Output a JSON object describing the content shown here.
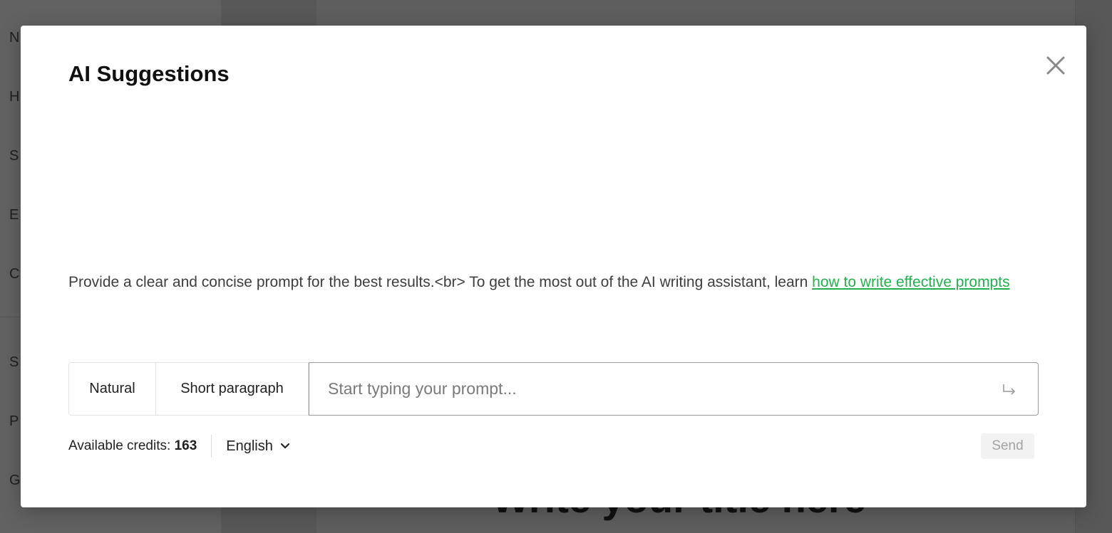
{
  "background": {
    "sidebar_letters": [
      "N",
      "H",
      "S",
      "E",
      "C",
      "S",
      "P",
      "G"
    ],
    "editor_title": "Write your title here"
  },
  "modal": {
    "title": "AI Suggestions",
    "hint_text": "Provide a clear and concise prompt for the best results.<br> To get the most out of the AI writing assistant, learn ",
    "hint_link": "how to write effective prompts",
    "tone_button": "Natural",
    "length_button": "Short paragraph",
    "prompt_placeholder": "Start typing your prompt...",
    "prompt_value": "",
    "credits_label": "Available credits: ",
    "credits_value": "163",
    "language": "English",
    "send_label": "Send"
  },
  "colors": {
    "link": "#22b14c",
    "overlay": "#5f5f5f",
    "send_disabled_bg": "#f2f2f2"
  }
}
